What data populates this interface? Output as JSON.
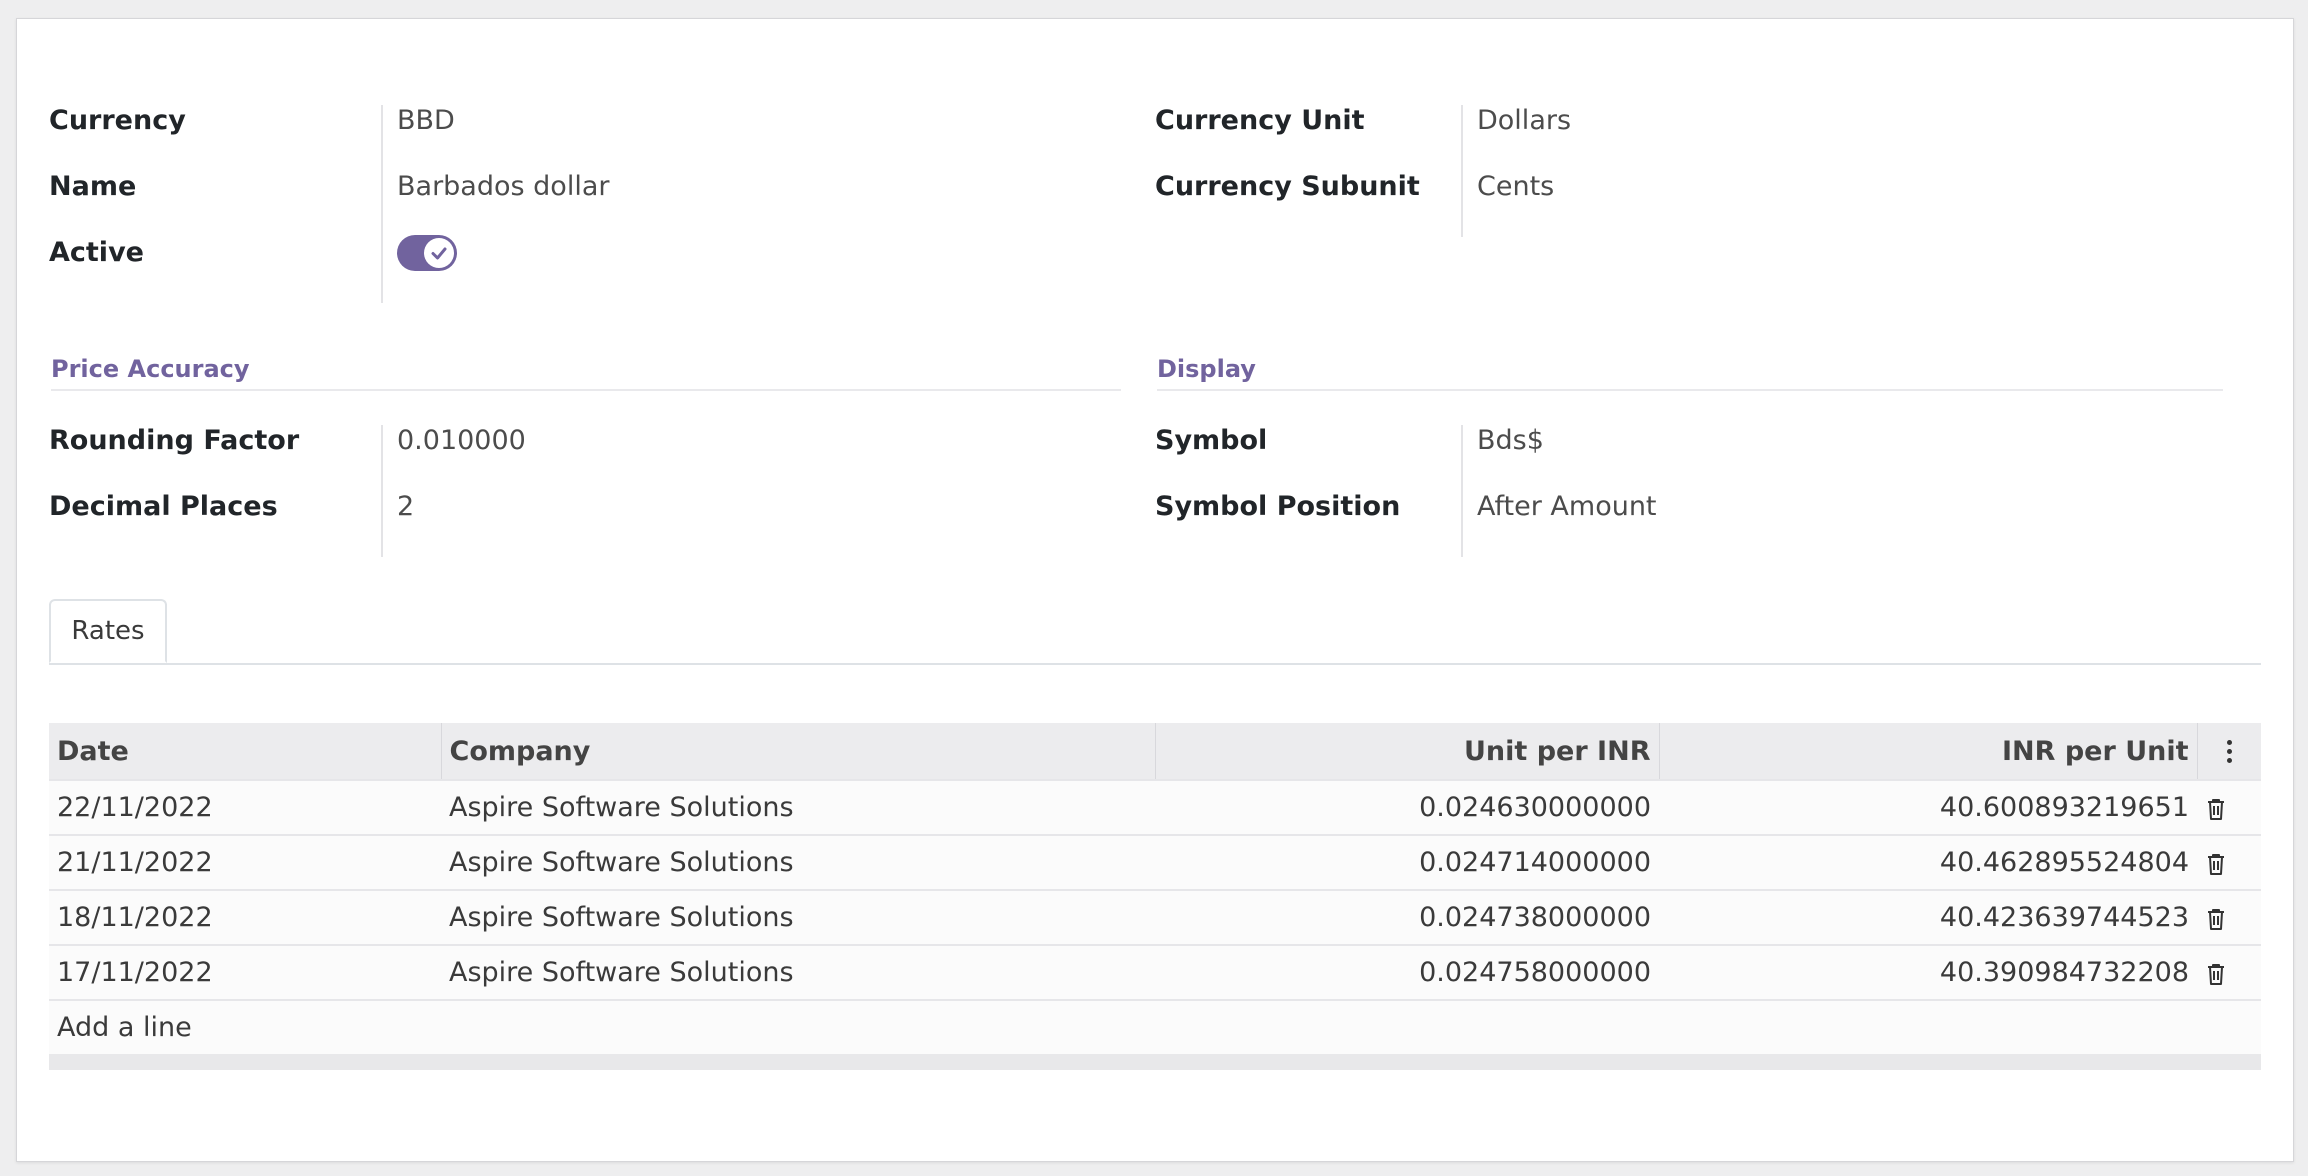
{
  "form": {
    "currency": {
      "label": "Currency",
      "value": "BBD"
    },
    "name": {
      "label": "Name",
      "value": "Barbados dollar"
    },
    "active": {
      "label": "Active",
      "value": true
    },
    "currency_unit": {
      "label": "Currency Unit",
      "value": "Dollars"
    },
    "currency_subunit": {
      "label": "Currency Subunit",
      "value": "Cents"
    }
  },
  "price_accuracy": {
    "title": "Price Accuracy",
    "rounding_factor": {
      "label": "Rounding Factor",
      "value": "0.010000"
    },
    "decimal_places": {
      "label": "Decimal Places",
      "value": "2"
    }
  },
  "display": {
    "title": "Display",
    "symbol": {
      "label": "Symbol",
      "value": "Bds$"
    },
    "symbol_position": {
      "label": "Symbol Position",
      "value": "After Amount"
    }
  },
  "tabs": [
    {
      "label": "Rates",
      "active": true
    }
  ],
  "rates": {
    "columns": [
      "Date",
      "Company",
      "Unit per INR",
      "INR per Unit"
    ],
    "rows": [
      {
        "date": "22/11/2022",
        "company": "Aspire Software Solutions",
        "unit_per_inr": "0.024630000000",
        "inr_per_unit": "40.600893219651"
      },
      {
        "date": "21/11/2022",
        "company": "Aspire Software Solutions",
        "unit_per_inr": "0.024714000000",
        "inr_per_unit": "40.462895524804"
      },
      {
        "date": "18/11/2022",
        "company": "Aspire Software Solutions",
        "unit_per_inr": "0.024738000000",
        "inr_per_unit": "40.423639744523"
      },
      {
        "date": "17/11/2022",
        "company": "Aspire Software Solutions",
        "unit_per_inr": "0.024758000000",
        "inr_per_unit": "40.390984732208"
      }
    ],
    "add_line": "Add a line"
  },
  "colors": {
    "accent": "#71639e"
  },
  "icons": {
    "row_delete": "trash-icon",
    "optional_columns": "kebab-menu-icon",
    "active_toggle": "check-icon"
  }
}
